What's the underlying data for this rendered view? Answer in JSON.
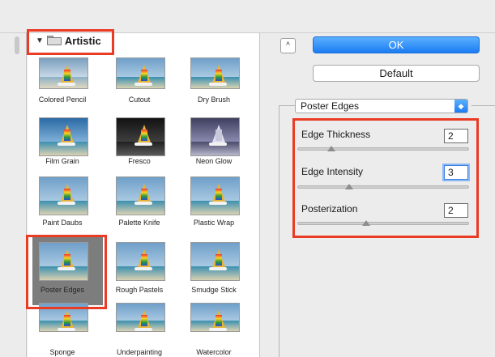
{
  "category": {
    "name": "Artistic",
    "expanded": true
  },
  "thumbnails": [
    {
      "label": "Colored Pencil",
      "style": "pencil"
    },
    {
      "label": "Cutout",
      "style": ""
    },
    {
      "label": "Dry Brush",
      "style": ""
    },
    {
      "label": "Film Grain",
      "style": "grain"
    },
    {
      "label": "Fresco",
      "style": "dark"
    },
    {
      "label": "Neon Glow",
      "style": "neon"
    },
    {
      "label": "Paint Daubs",
      "style": ""
    },
    {
      "label": "Palette Knife",
      "style": ""
    },
    {
      "label": "Plastic Wrap",
      "style": ""
    },
    {
      "label": "Poster Edges",
      "style": "",
      "selected": true
    },
    {
      "label": "Rough Pastels",
      "style": ""
    },
    {
      "label": "Smudge Stick",
      "style": ""
    },
    {
      "label": "Sponge",
      "style": ""
    },
    {
      "label": "Underpainting",
      "style": ""
    },
    {
      "label": "Watercolor",
      "style": ""
    }
  ],
  "buttons": {
    "collapse": "^",
    "ok": "OK",
    "default": "Default"
  },
  "filter": {
    "selected": "Poster Edges"
  },
  "params": [
    {
      "label": "Edge Thickness",
      "value": "2",
      "level": 0.2
    },
    {
      "label": "Edge Intensity",
      "value": "3",
      "level": 0.3
    },
    {
      "label": "Posterization",
      "value": "2",
      "level": 0.4
    }
  ],
  "colors": {
    "highlight": "#ea3b24",
    "accent": "#1b7cf2"
  }
}
